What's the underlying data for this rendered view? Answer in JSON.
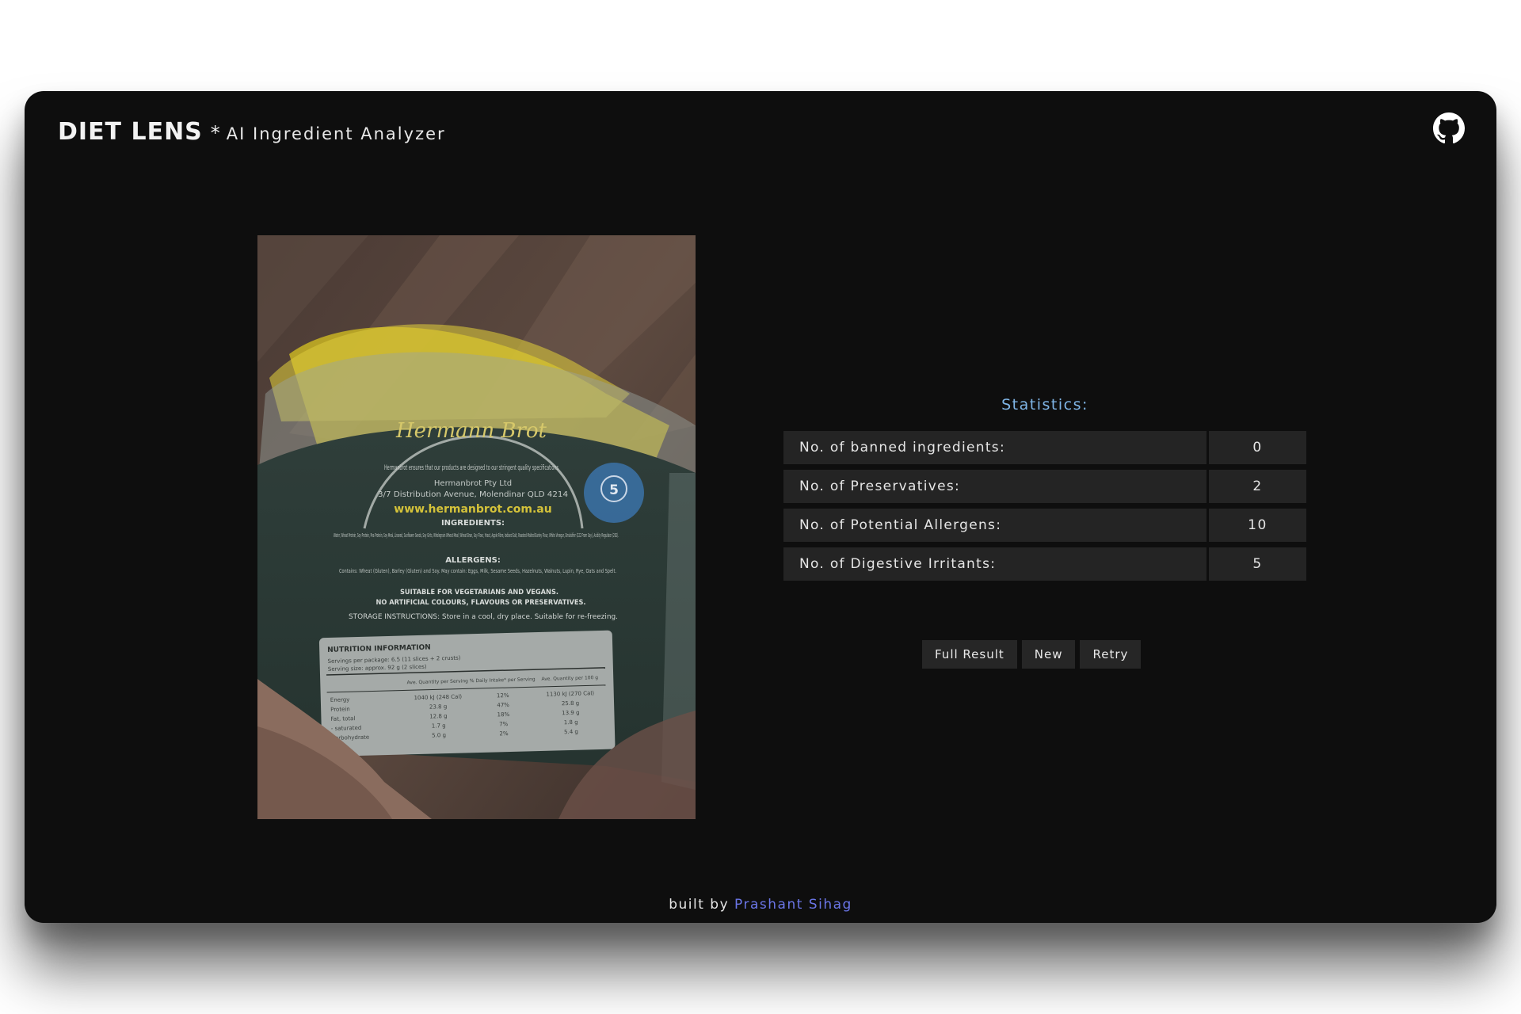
{
  "header": {
    "brand": "DIET LENS",
    "separator": "*",
    "subtitle": "AI Ingredient Analyzer",
    "github_icon": "github-icon"
  },
  "photo": {
    "brand_script": "Hermann Brot",
    "tagline": "Hermanbrot ensures that our products are designed to our stringent quality specifications",
    "company": "Hermanbrot Pty Ltd",
    "address": "3/7 Distribution Avenue, Molendinar QLD 4214",
    "website": "www.hermanbrot.com.au",
    "ingredients_heading": "INGREDIENTS:",
    "ingredients_text": "Water, Wheat Protein, Soy Protein, Pea Protein, Soy Meal, Linseed, Sunflower Seeds, Soy Grits, Wholegrain Wheat Meal, Wheat Bran, Soy Flour, Yeast, Apple Fibre, Iodised Salt, Roasted Malted Barley Flour, White Vinegar, Emulsifier (322 From Soy), Acidity Regulator (262).",
    "allergens_heading": "ALLERGENS:",
    "allergens_text": "Contains: Wheat (Gluten), Barley (Gluten) and Soy. May contain: Eggs, Milk, Sesame Seeds, Hazelnuts, Walnuts, Lupin, Rye, Oats and Spelt.",
    "veg_line1": "SUITABLE FOR VEGETARIANS AND VEGANS.",
    "veg_line2": "NO ARTIFICIAL COLOURS, FLAVOURS OR PRESERVATIVES.",
    "storage": "STORAGE INSTRUCTIONS: Store in a cool, dry place. Suitable for re-freezing.",
    "nutrition_title": "NUTRITION INFORMATION",
    "servings_per_package": "Servings per package: 6.5 (11 slices + 2 crusts)",
    "serving_size": "Serving size: approx. 92 g (2 slices)",
    "nutrition_headers": [
      "Ave. Quantity per Serving",
      "% Daily Intake* per Serving",
      "Ave. Quantity per 100 g"
    ],
    "nutrition_rows": [
      [
        "Energy",
        "1040 kJ (248 Cal)",
        "12%",
        "1130 kJ (270 Cal)"
      ],
      [
        "Protein",
        "23.8 g",
        "47%",
        "25.8 g"
      ],
      [
        "Fat, total",
        "12.8 g",
        "18%",
        "13.9 g"
      ],
      [
        "- saturated",
        "1.7 g",
        "7%",
        "1.8 g"
      ],
      [
        "Carbohydrate",
        "5.0 g",
        "2%",
        "5.4 g"
      ]
    ],
    "star_badge": "5"
  },
  "stats": {
    "title": "Statistics:",
    "rows": [
      {
        "label": "No. of banned ingredients:",
        "value": "0"
      },
      {
        "label": "No. of Preservatives:",
        "value": "2"
      },
      {
        "label": "No. of Potential Allergens:",
        "value": "10"
      },
      {
        "label": "No. of Digestive Irritants:",
        "value": "5"
      }
    ]
  },
  "actions": {
    "full_result": "Full Result",
    "new": "New",
    "retry": "Retry"
  },
  "footer": {
    "prefix": "built by",
    "author": "Prashant Sihag"
  }
}
